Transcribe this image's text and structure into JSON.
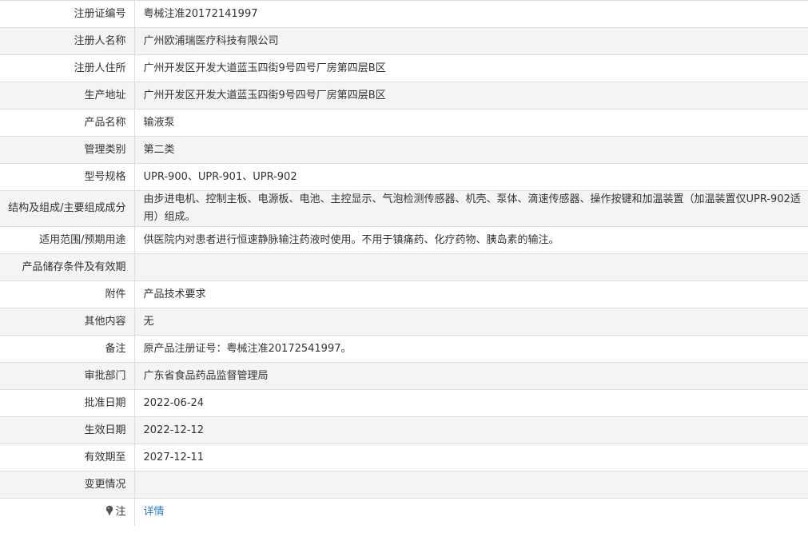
{
  "rows": [
    {
      "label": "注册证编号",
      "value": "粤械注准20172141997"
    },
    {
      "label": "注册人名称",
      "value": "广州欧浦瑞医疗科技有限公司"
    },
    {
      "label": "注册人住所",
      "value": "广州开发区开发大道蓝玉四街9号四号厂房第四层B区"
    },
    {
      "label": "生产地址",
      "value": "广州开发区开发大道蓝玉四街9号四号厂房第四层B区"
    },
    {
      "label": "产品名称",
      "value": "输液泵"
    },
    {
      "label": "管理类别",
      "value": "第二类"
    },
    {
      "label": "型号规格",
      "value": "UPR-900、UPR-901、UPR-902"
    },
    {
      "label": "结构及组成/主要组成成分",
      "value": "由步进电机、控制主板、电源板、电池、主控显示、气泡检测传感器、机壳、泵体、滴速传感器、操作按键和加温装置（加温装置仅UPR-902适用）组成。"
    },
    {
      "label": "适用范围/预期用途",
      "value": "供医院内对患者进行恒速静脉输注药液时使用。不用于镇痛药、化疗药物、胰岛素的输注。"
    },
    {
      "label": "产品储存条件及有效期",
      "value": ""
    },
    {
      "label": "附件",
      "value": "产品技术要求"
    },
    {
      "label": "其他内容",
      "value": "无"
    },
    {
      "label": "备注",
      "value": "原产品注册证号：粤械注准20172541997。"
    },
    {
      "label": "审批部门",
      "value": "广东省食品药品监督管理局"
    },
    {
      "label": "批准日期",
      "value": "2022-06-24"
    },
    {
      "label": "生效日期",
      "value": "2022-12-12"
    },
    {
      "label": "有效期至",
      "value": "2027-12-11"
    },
    {
      "label": "变更情况",
      "value": ""
    }
  ],
  "note": {
    "icon": "pin-icon",
    "label": "注",
    "link_text": "详情"
  }
}
